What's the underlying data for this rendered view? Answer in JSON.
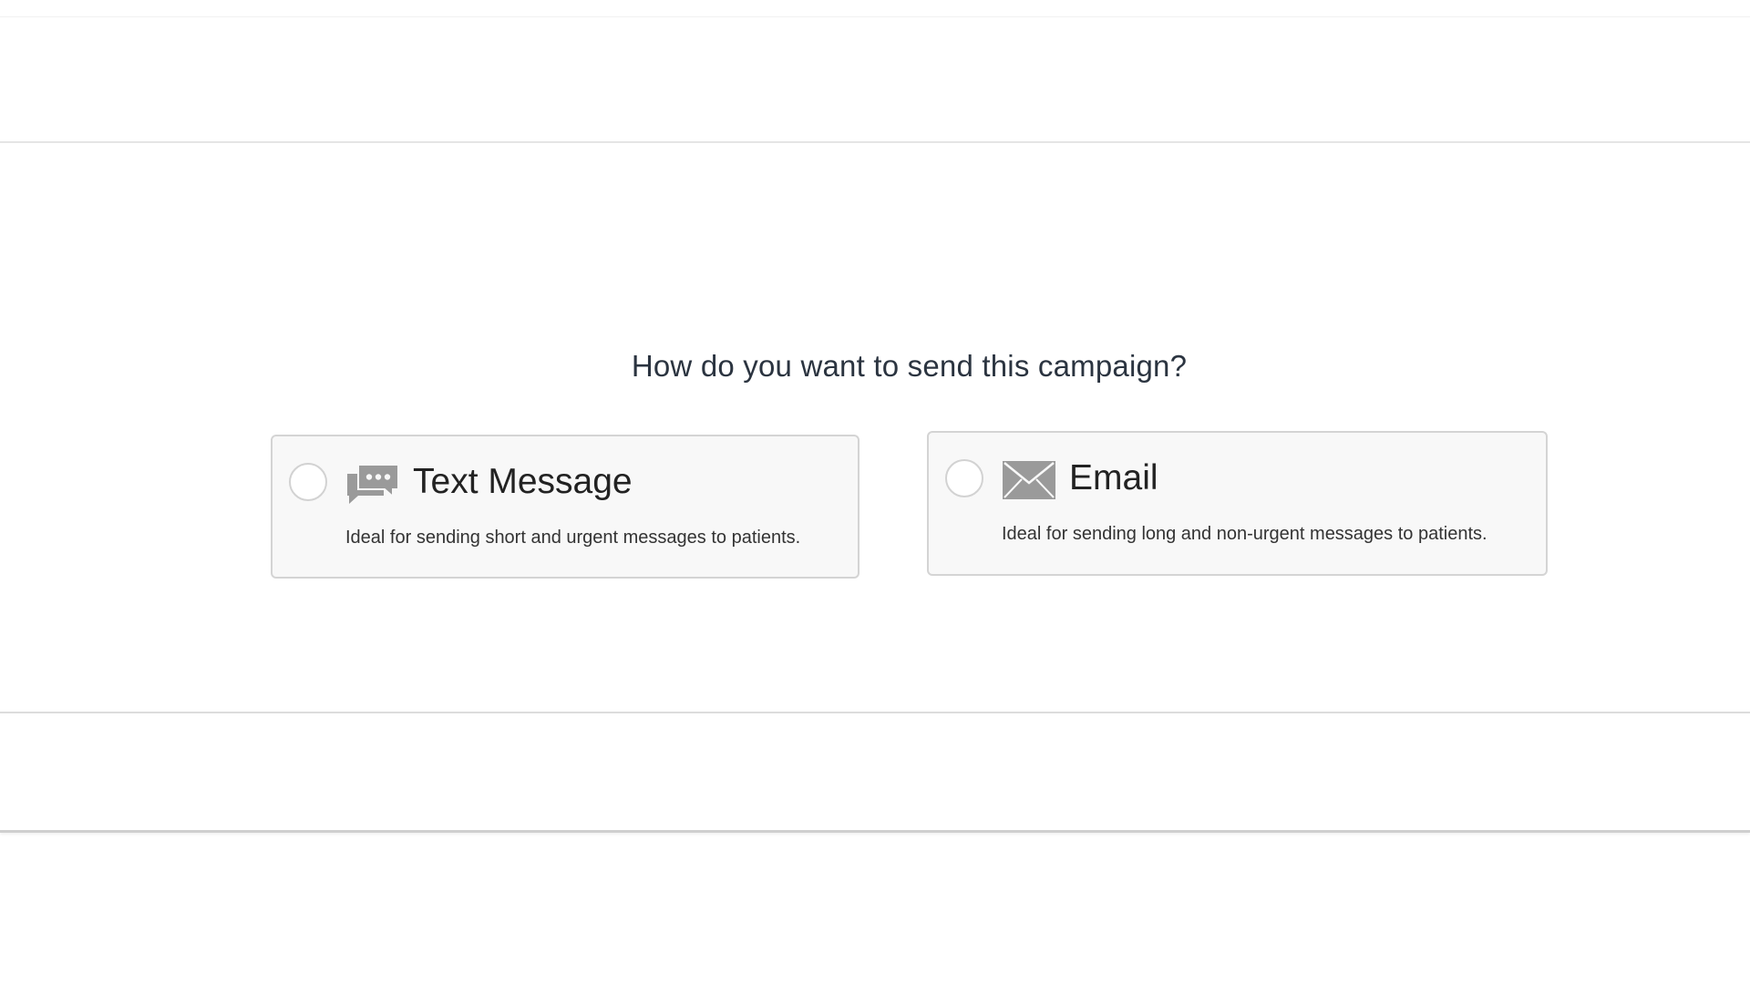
{
  "prompt": {
    "question": "How do you want to send this campaign?"
  },
  "options": [
    {
      "title": "Text Message",
      "description": "Ideal for sending short and urgent messages to patients.",
      "icon": "chat-bubbles-icon",
      "selected": false
    },
    {
      "title": "Email",
      "description": "Ideal for sending long and non-urgent messages to patients.",
      "icon": "envelope-icon",
      "selected": false
    }
  ],
  "colors": {
    "card_background": "#f8f8f8",
    "card_border": "#d4d4d4",
    "icon_gray": "#9a9a9a",
    "text_dark": "#2b3440"
  }
}
